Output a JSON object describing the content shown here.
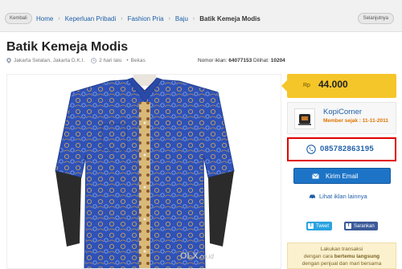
{
  "nav": {
    "back_label": "Kembali",
    "next_label": "Selanjutnya",
    "breadcrumbs": [
      "Home",
      "Keperluan Pribadi",
      "Fashion Pria",
      "Baju",
      "Batik Kemeja Modis"
    ]
  },
  "listing": {
    "title": "Batik Kemeja Modis",
    "location": "Jakarta Selatan, Jakarta D.K.I.",
    "posted": "2 hari lalu",
    "condition": "Bekas",
    "ad_number_label": "Nomor iklan:",
    "ad_number": "64077153",
    "views_label": "Dilihat:",
    "views": "10204",
    "watermark_brand": "OLX",
    "watermark_suffix": ".co.id"
  },
  "price": {
    "currency": "Rp",
    "value": "44.000"
  },
  "seller": {
    "name": "KopiCorner",
    "member_since": "Member sejak : 11-11-2011",
    "phone": "085782863195"
  },
  "actions": {
    "email_label": "Kirim Email",
    "more_ads_label": "Lihat iklan lainnya",
    "tweet_label": "Tweet",
    "share_label": "Sarankan"
  },
  "tip": {
    "line1": "Lakukan transaksi",
    "line2_pre": "dengan cara",
    "line2_bold": "bertemu langsung",
    "line3": "dengan penjual dan mari bersama"
  },
  "colors": {
    "price_bg": "#f5c62a",
    "link": "#1f5fa8",
    "email_button": "#1d74c7",
    "phone_highlight_border": "#e00000",
    "member_since": "#e07400"
  }
}
